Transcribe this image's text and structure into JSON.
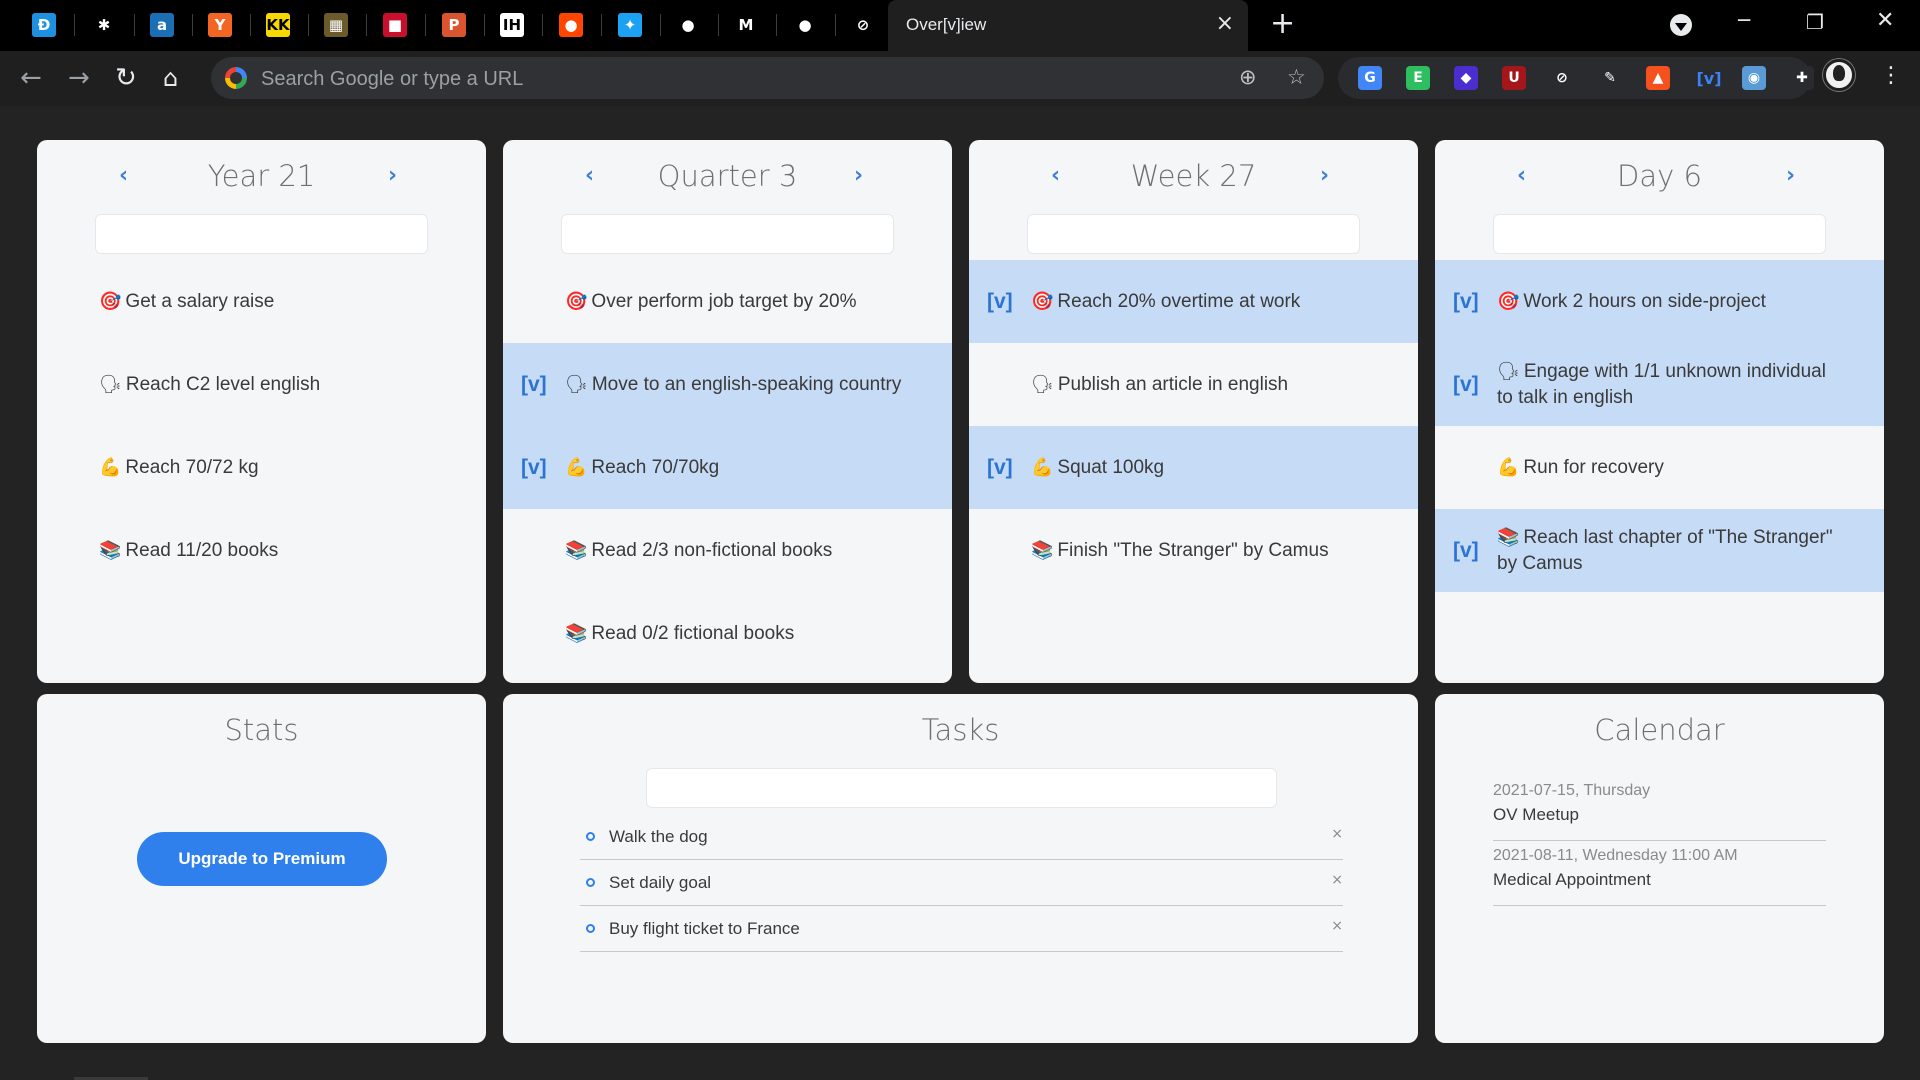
{
  "browser": {
    "pinned_tabs": [
      {
        "name": "d-logo-icon",
        "glyph": "Ð",
        "bg": "#1e90e0"
      },
      {
        "name": "asterisk-app-icon",
        "glyph": "✱",
        "bg": "#000000"
      },
      {
        "name": "a-logo-icon",
        "glyph": "a",
        "bg": "#1a6fb5"
      },
      {
        "name": "y-combinator-icon",
        "glyph": "Y",
        "bg": "#f26522"
      },
      {
        "name": "kk-logo-icon",
        "glyph": "KK",
        "bg": "#f7d800"
      },
      {
        "name": "newspaper-icon",
        "glyph": "▦",
        "bg": "#6b5a2a"
      },
      {
        "name": "flag-icon",
        "glyph": "■",
        "bg": "#c8102e"
      },
      {
        "name": "producthunt-icon",
        "glyph": "P",
        "bg": "#da552f"
      },
      {
        "name": "ih-logo-icon",
        "glyph": "IH",
        "bg": "#ffffff"
      },
      {
        "name": "reddit-icon",
        "glyph": "●",
        "bg": "#ff4500"
      },
      {
        "name": "twitter-icon",
        "glyph": "✦",
        "bg": "#1da1f2"
      },
      {
        "name": "github-icon",
        "glyph": "●",
        "bg": "#000000"
      },
      {
        "name": "gmail-icon",
        "glyph": "M",
        "bg": "#000000"
      },
      {
        "name": "apple-icon",
        "glyph": "●",
        "bg": "#000000"
      },
      {
        "name": "overview-app-icon",
        "glyph": "⊘",
        "bg": "#000000"
      }
    ],
    "active_tab_title": "Over[v]iew",
    "tab_close": "×",
    "new_tab": "+",
    "omnibox_placeholder": "Search Google or type a URL",
    "extensions": [
      {
        "name": "google-translate-icon",
        "glyph": "G",
        "bg": "#4285f4"
      },
      {
        "name": "evernote-icon",
        "glyph": "E",
        "bg": "#2dbe60"
      },
      {
        "name": "stack-layers-icon",
        "glyph": "◆",
        "bg": "#4c2ecf"
      },
      {
        "name": "ublock-icon",
        "glyph": "U",
        "bg": "#a4161a"
      },
      {
        "name": "overview-ext-icon",
        "glyph": "⊘",
        "bg": "#2a2b2e"
      },
      {
        "name": "pen-tool-icon",
        "glyph": "✎",
        "bg": "#2a2b2e"
      },
      {
        "name": "lighthouse-icon",
        "glyph": "▲",
        "bg": "#f4511e"
      },
      {
        "name": "v-bracket-icon",
        "glyph": "[v]",
        "bg": "#2a2b2e"
      },
      {
        "name": "globe-icon",
        "glyph": "◉",
        "bg": "#5b9bd5"
      },
      {
        "name": "puzzle-icon",
        "glyph": "✚",
        "bg": "#2a2b2e"
      }
    ]
  },
  "periods": [
    {
      "title": "Year 21",
      "goals": [
        {
          "emoji": "🎯",
          "text": "Get a salary raise",
          "done": false,
          "mark": ""
        },
        {
          "emoji": "🗣",
          "text": "Reach C2 level english",
          "done": false,
          "mark": ""
        },
        {
          "emoji": "💪",
          "text": "Reach 70/72 kg",
          "done": false,
          "mark": ""
        },
        {
          "emoji": "📚",
          "text": "Read 11/20 books",
          "done": false,
          "mark": ""
        }
      ]
    },
    {
      "title": "Quarter 3",
      "goals": [
        {
          "emoji": "🎯",
          "text": "Over perform job target by 20%",
          "done": false,
          "mark": ""
        },
        {
          "emoji": "🗣",
          "text": "Move to an english-speaking country",
          "done": true,
          "mark": "[v]"
        },
        {
          "emoji": "💪",
          "text": "Reach 70/70kg",
          "done": true,
          "mark": "[v]"
        },
        {
          "emoji": "📚",
          "text": "Read 2/3 non-fictional books",
          "done": false,
          "mark": ""
        },
        {
          "emoji": "📚",
          "text": "Read 0/2 fictional books",
          "done": false,
          "mark": ""
        }
      ]
    },
    {
      "title": "Week 27",
      "goals": [
        {
          "emoji": "🎯",
          "text": "Reach 20% overtime at work",
          "done": true,
          "mark": "[v]"
        },
        {
          "emoji": "🗣",
          "text": "Publish an article in english",
          "done": false,
          "mark": ""
        },
        {
          "emoji": "💪",
          "text": "Squat 100kg",
          "done": true,
          "mark": "[v]"
        },
        {
          "emoji": "📚",
          "text": "Finish \"The Stranger\" by Camus",
          "done": false,
          "mark": ""
        }
      ]
    },
    {
      "title": "Day 6",
      "goals": [
        {
          "emoji": "🎯",
          "text": "Work 2 hours on side-project",
          "done": true,
          "mark": "[v]"
        },
        {
          "emoji": "🗣",
          "text": "Engage with 1/1 unknown individual to talk in english",
          "done": true,
          "mark": "[v]"
        },
        {
          "emoji": "💪",
          "text": "Run for recovery",
          "done": false,
          "mark": ""
        },
        {
          "emoji": "📚",
          "text": "Reach last chapter of \"The Stranger\" by Camus",
          "done": true,
          "mark": "[v]"
        }
      ]
    }
  ],
  "nav": {
    "prev": "‹",
    "next": "›"
  },
  "stats": {
    "title": "Stats",
    "button": "Upgrade to Premium"
  },
  "tasks": {
    "title": "Tasks",
    "items": [
      {
        "label": "Walk the dog",
        "remove": "×"
      },
      {
        "label": "Set daily goal",
        "remove": "×"
      },
      {
        "label": "Buy flight ticket to France",
        "remove": "×"
      }
    ]
  },
  "calendar": {
    "title": "Calendar",
    "events": [
      {
        "date": "2021-07-15, Thursday",
        "name": "OV Meetup"
      },
      {
        "date": "2021-08-11, Wednesday 11:00 AM",
        "name": "Medical Appointment"
      }
    ]
  },
  "colors": {
    "done_row": "#c6dbf6",
    "accent": "#2f80ed",
    "page_bg": "#232323",
    "card_bg": "#f5f6f8"
  }
}
